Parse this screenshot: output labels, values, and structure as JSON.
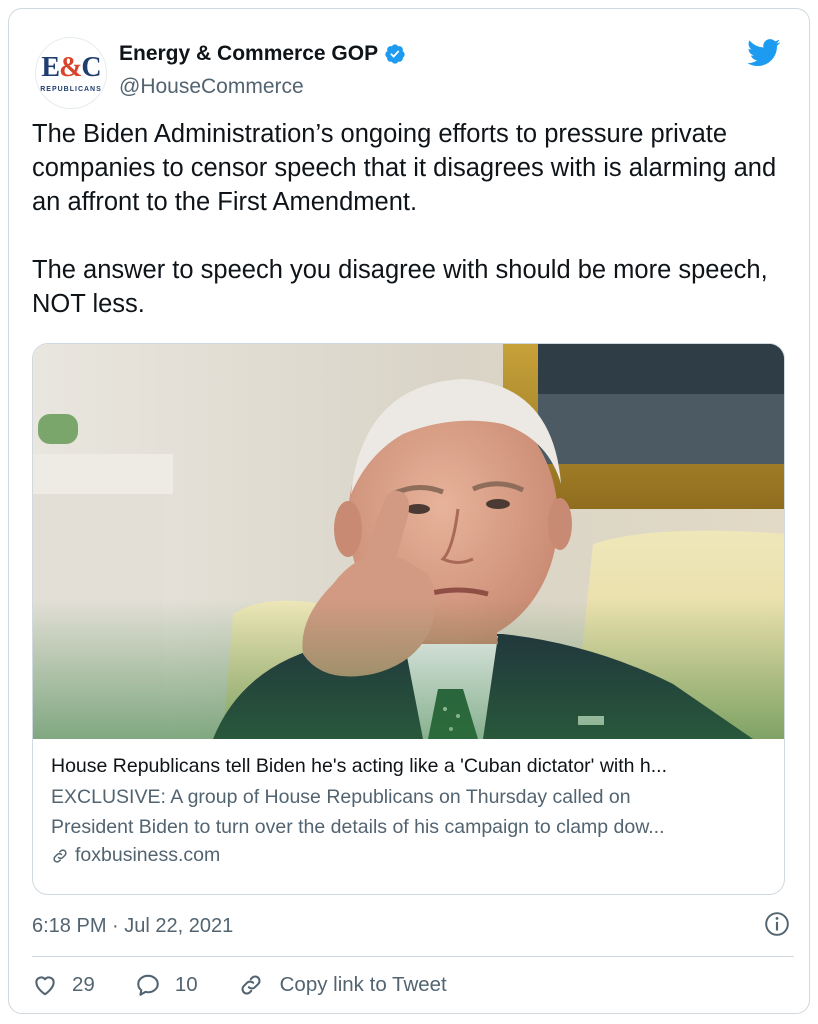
{
  "account": {
    "display_name": "Energy & Commerce GOP",
    "handle": "@HouseCommerce",
    "avatar_text_top_left": "E",
    "avatar_text_amp": "&",
    "avatar_text_top_right": "C",
    "avatar_text_bottom": "REPUBLICANS",
    "verified": true
  },
  "tweet": {
    "paragraphs": [
      "The Biden Administration’s ongoing efforts to pressure private companies to censor speech that it disagrees with is alarming and an affront to the First Amendment.",
      "The answer to speech you disagree with should be more speech, NOT less."
    ],
    "timestamp": "6:18 PM · Jul 22, 2021"
  },
  "link_card": {
    "title": "House Republicans tell Biden he's acting like a 'Cuban dictator' with h...",
    "description_line1": "EXCLUSIVE: A group of House Republicans on Thursday called on",
    "description_line2": "President Biden to turn over the details of his campaign to clamp dow...",
    "domain": "foxbusiness.com"
  },
  "actions": {
    "likes": "29",
    "replies": "10",
    "copy_link_label": "Copy link to Tweet"
  },
  "icons": {
    "verified": "verified-badge-icon",
    "brand": "twitter-bird-icon",
    "info": "info-icon",
    "like": "heart-icon",
    "reply": "reply-bubble-icon",
    "link": "link-chain-icon"
  },
  "colors": {
    "brand_blue": "#1d9bf0",
    "text": "#0f1419",
    "secondary_text": "#536471",
    "border": "#cfd9de"
  }
}
